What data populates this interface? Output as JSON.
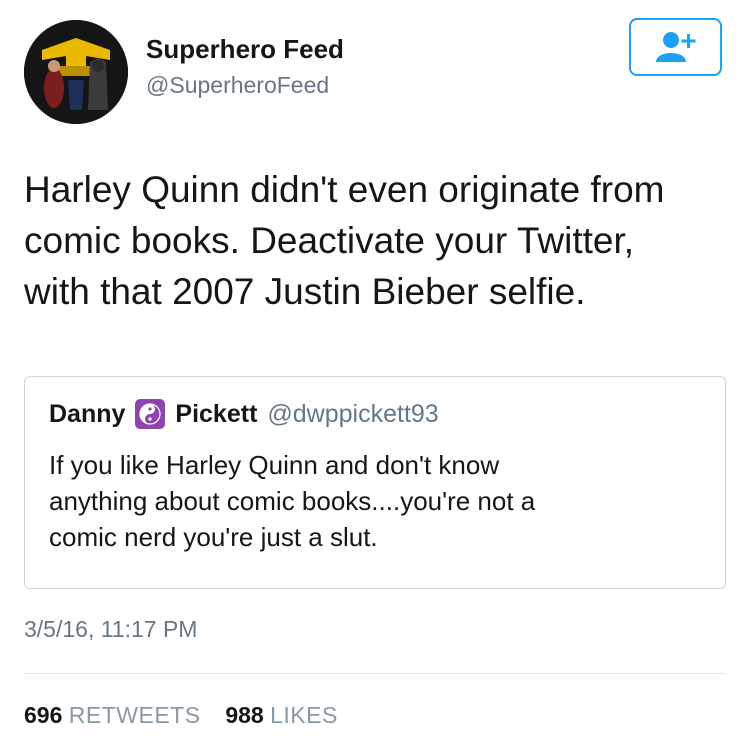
{
  "account": {
    "display_name": "Superhero Feed",
    "handle": "@SuperheroFeed"
  },
  "tweet": {
    "text": "Harley Quinn didn't even originate from\ncomic books. Deactivate your Twitter,\nwith that 2007 Justin Bieber selfie.",
    "timestamp": "3/5/16, 11:17 PM"
  },
  "quoted_tweet": {
    "name_first": "Danny",
    "name_emoji": "yin-yang-icon",
    "name_last": "Pickett",
    "handle": "@dwppickett93",
    "text": "If you like Harley Quinn and don't know\nanything about comic books....you're not a\ncomic nerd you're just a slut."
  },
  "stats": {
    "retweets_count": "696",
    "retweets_label": "RETWEETS",
    "likes_count": "988",
    "likes_label": "LIKES"
  },
  "colors": {
    "accent": "#1da1f2",
    "secondary_text": "#657786",
    "emoji_purple": "#8e44ad"
  }
}
